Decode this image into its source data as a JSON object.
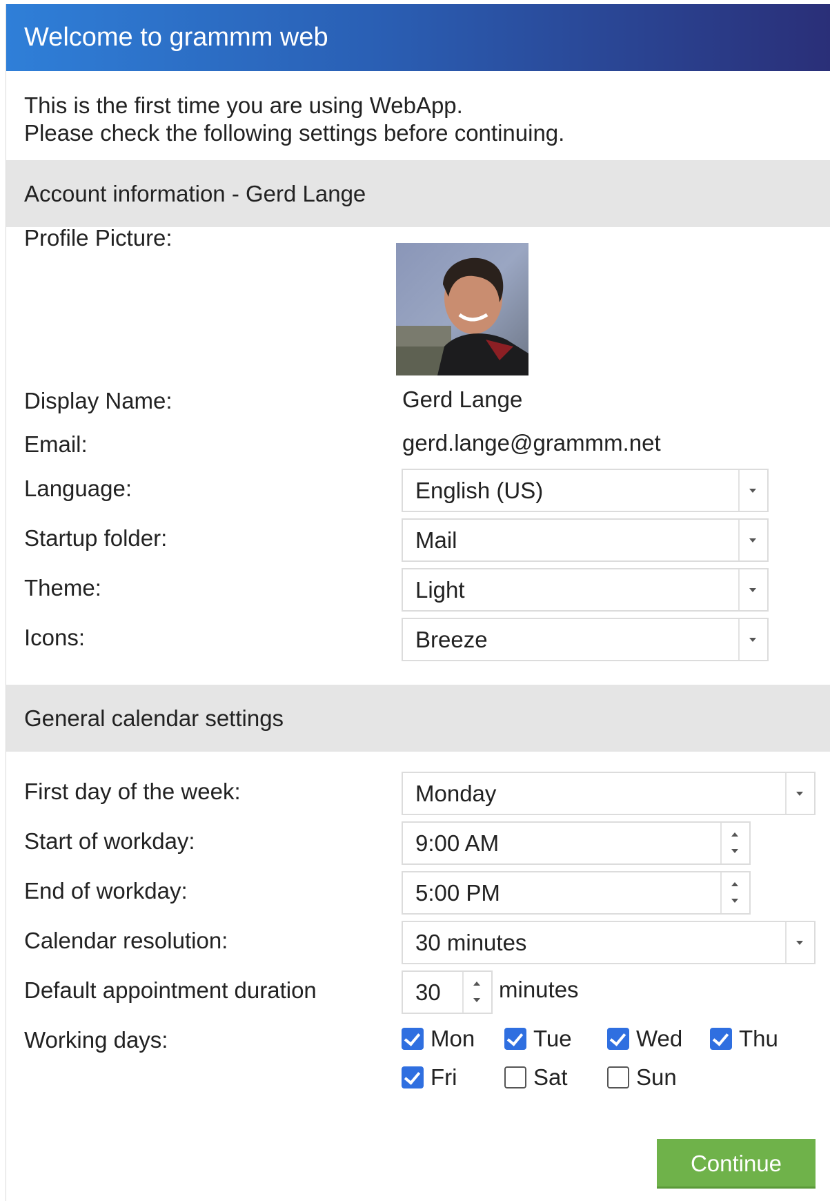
{
  "window": {
    "title": "Welcome to grammm web"
  },
  "intro": {
    "line1": "This is the first time you are using WebApp.",
    "line2": "Please check the following settings before continuing."
  },
  "account": {
    "header": "Account information - Gerd Lange",
    "profile_picture_label": "Profile Picture:",
    "display_name_label": "Display Name:",
    "display_name": "Gerd Lange",
    "email_label": "Email:",
    "email": "gerd.lange@grammm.net",
    "language_label": "Language:",
    "language": "English (US)",
    "startup_folder_label": "Startup folder:",
    "startup_folder": "Mail",
    "theme_label": "Theme:",
    "theme": "Light",
    "icons_label": "Icons:",
    "icons": "Breeze"
  },
  "calendar": {
    "header": "General calendar settings",
    "first_day_label": "First day of the week:",
    "first_day": "Monday",
    "start_label": "Start of workday:",
    "start": "9:00 AM",
    "end_label": "End of workday:",
    "end": "5:00 PM",
    "resolution_label": "Calendar resolution:",
    "resolution": "30 minutes",
    "duration_label": "Default appointment duration",
    "duration": "30",
    "duration_unit": "minutes",
    "working_days_label": "Working days:",
    "days": [
      {
        "label": "Mon",
        "checked": true
      },
      {
        "label": "Tue",
        "checked": true
      },
      {
        "label": "Wed",
        "checked": true
      },
      {
        "label": "Thu",
        "checked": true
      },
      {
        "label": "Fri",
        "checked": true
      },
      {
        "label": "Sat",
        "checked": false
      },
      {
        "label": "Sun",
        "checked": false
      }
    ]
  },
  "footer": {
    "continue_label": "Continue"
  },
  "colors": {
    "title_gradient_start": "#2f7fd8",
    "title_gradient_end": "#2a2f78",
    "section_bg": "#e5e5e5",
    "checkbox_checked": "#2f6fe0",
    "continue_button": "#6fb24a"
  }
}
